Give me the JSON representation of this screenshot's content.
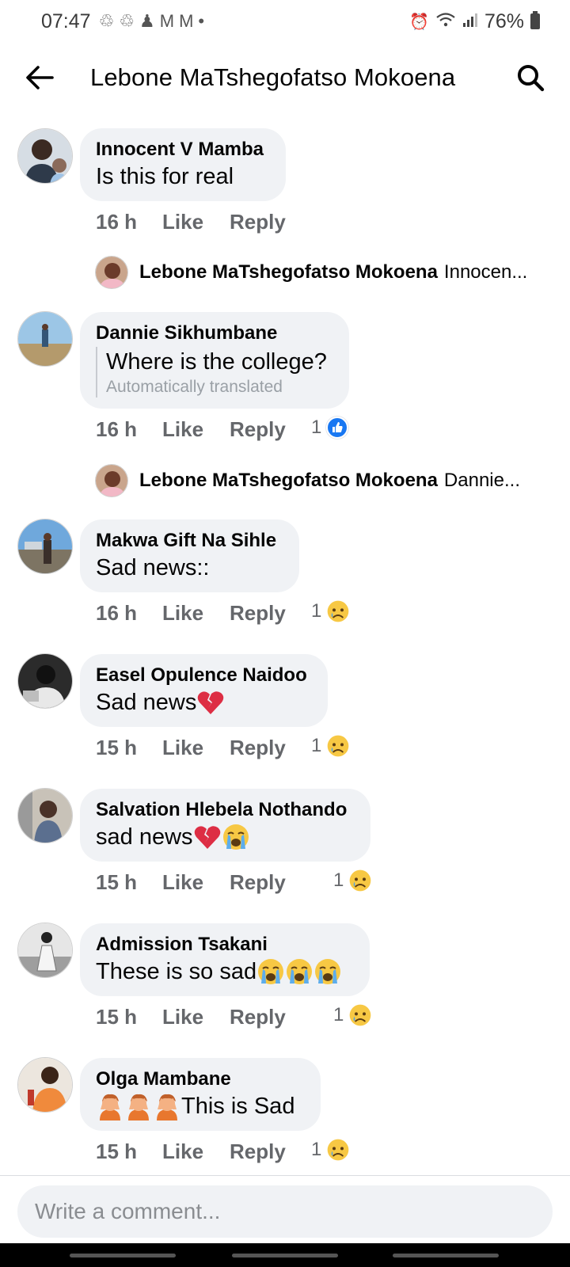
{
  "status_bar": {
    "time": "07:47",
    "battery": "76%",
    "left_icons": [
      "sync-icon",
      "sync-icon",
      "bell-icon",
      "gmail-icon",
      "gmail-icon",
      "dot-icon"
    ],
    "right_icons": [
      "alarm-icon",
      "wifi-icon",
      "signal-icon",
      "battery-icon"
    ]
  },
  "header": {
    "title": "Lebone MaTshegofatso Mokoena"
  },
  "comments": [
    {
      "author": "Innocent V Mamba",
      "text": "Is this for real",
      "emojis": [],
      "time": "16 h",
      "like": "Like",
      "reply": "Reply",
      "reaction": null
    },
    {
      "author": "Dannie Sikhumbane",
      "text": "Where is the college?",
      "translated_note": "Automatically translated",
      "time": "16 h",
      "like": "Like",
      "reply": "Reply",
      "reaction": {
        "count": "1",
        "type": "like"
      }
    },
    {
      "author": "Makwa Gift Na Sihle",
      "text": "Sad news::",
      "emojis": [],
      "time": "16 h",
      "like": "Like",
      "reply": "Reply",
      "reaction": {
        "count": "1",
        "type": "sad"
      }
    },
    {
      "author": "Easel Opulence Naidoo",
      "text": "Sad news",
      "emojis": [
        "broken-heart"
      ],
      "time": "15 h",
      "like": "Like",
      "reply": "Reply",
      "reaction": {
        "count": "1",
        "type": "sad"
      }
    },
    {
      "author": "Salvation Hlebela Nothando",
      "text": "sad news",
      "emojis": [
        "broken-heart",
        "crying-face"
      ],
      "time": "15 h",
      "like": "Like",
      "reply": "Reply",
      "reaction": {
        "count": "1",
        "type": "sad"
      }
    },
    {
      "author": "Admission Tsakani",
      "text": "These is so sad",
      "emojis": [
        "crying-face",
        "crying-face",
        "crying-face"
      ],
      "time": "15 h",
      "like": "Like",
      "reply": "Reply",
      "reaction": {
        "count": "1",
        "type": "sad"
      }
    },
    {
      "author": "Olga Mambane",
      "text": "This is Sad",
      "emojis_before": [
        "facepalm-person",
        "facepalm-person",
        "facepalm-person"
      ],
      "time": "15 h",
      "like": "Like",
      "reply": "Reply",
      "reaction": {
        "count": "1",
        "type": "sad"
      }
    }
  ],
  "replies": [
    {
      "author": "Lebone MaTshegofatso Mokoena",
      "preview": "Innocen..."
    },
    {
      "author": "Lebone MaTshegofatso Mokoena",
      "preview": "Dannie..."
    }
  ],
  "composer": {
    "placeholder": "Write a comment..."
  },
  "colors": {
    "bubble": "#f0f2f5",
    "secondary_text": "#65676b",
    "like_blue": "#1877f2",
    "sad_yellow": "#f7b928"
  }
}
